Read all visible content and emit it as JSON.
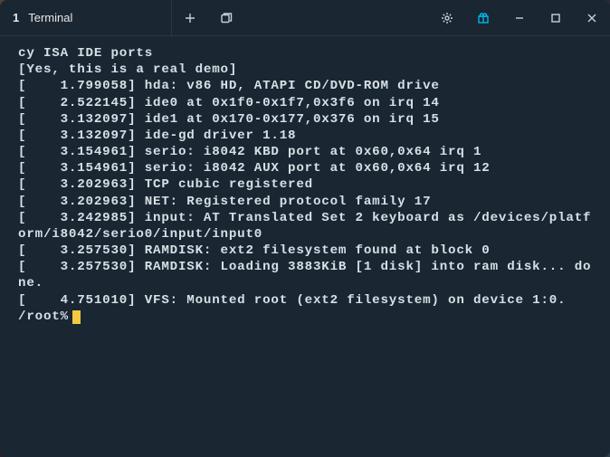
{
  "tab": {
    "index": "1",
    "title": "Terminal"
  },
  "lines": [
    "cy ISA IDE ports",
    "[Yes, this is a real demo]",
    "[    1.799058] hda: v86 HD, ATAPI CD/DVD-ROM drive",
    "[    2.522145] ide0 at 0x1f0-0x1f7,0x3f6 on irq 14",
    "[    3.132097] ide1 at 0x170-0x177,0x376 on irq 15",
    "[    3.132097] ide-gd driver 1.18",
    "[    3.154961] serio: i8042 KBD port at 0x60,0x64 irq 1",
    "[    3.154961] serio: i8042 AUX port at 0x60,0x64 irq 12",
    "[    3.202963] TCP cubic registered",
    "[    3.202963] NET: Registered protocol family 17",
    "[    3.242985] input: AT Translated Set 2 keyboard as /devices/platform/i8042/serio0/input/input0",
    "[    3.257530] RAMDISK: ext2 filesystem found at block 0",
    "[    3.257530] RAMDISK: Loading 3883KiB [1 disk] into ram disk... done.",
    "[    4.751010] VFS: Mounted root (ext2 filesystem) on device 1:0."
  ],
  "prompt": "/root%"
}
